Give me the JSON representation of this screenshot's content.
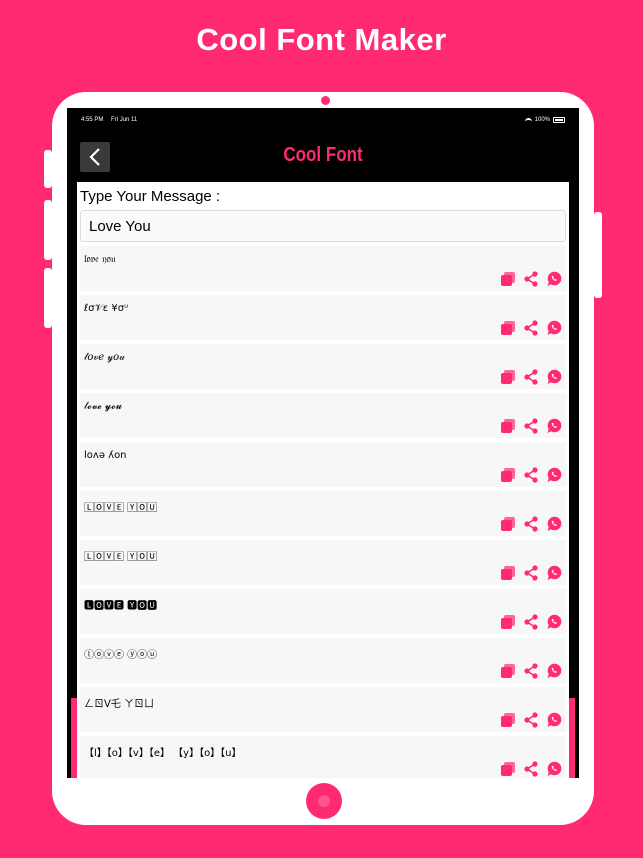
{
  "promo": {
    "title": "Cool Font Maker"
  },
  "status_bar": {
    "time": "4:55 PM",
    "date": "Fri Jun 11",
    "battery": "100%"
  },
  "nav": {
    "title": "Cool Font",
    "back_icon": "chevron-left-icon"
  },
  "input": {
    "label": "Type Your Message :",
    "value": "Love You"
  },
  "colors": {
    "accent": "#ff2a6f",
    "nav_bg": "#000000",
    "row_bg": "#f7f7f7"
  },
  "action_icons": [
    "copy-icon",
    "share-icon",
    "whatsapp-icon"
  ],
  "fonts": [
    {
      "text": "𝔩𝔬𝔳𝔢 𝔶𝔬𝔲"
    },
    {
      "text": "ℓσ𝒱ε ¥σᵘ"
    },
    {
      "text": "𝓁𝑜𝓋𝑒 𝓎𝑜𝓊"
    },
    {
      "text": "𝓁𝓸𝓿𝓮 𝔂𝓸𝓾"
    },
    {
      "text": "loʌǝ ʎon"
    },
    {
      "text": "🄻🄾🅅🄴 🅈🄾🅄"
    },
    {
      "text": "🄻🄾🅅🄴 🅈🄾🅄"
    },
    {
      "text": "🅻🅾🆅🅴 🆈🅾🆄"
    },
    {
      "text": "ⓛⓞⓥⓔ ⓨⓞⓤ"
    },
    {
      "text": "ㄥㄖᐯ乇 ㄚㄖㄩ"
    },
    {
      "text": "【l】【o】【v】【e】 【y】【o】【u】"
    }
  ]
}
